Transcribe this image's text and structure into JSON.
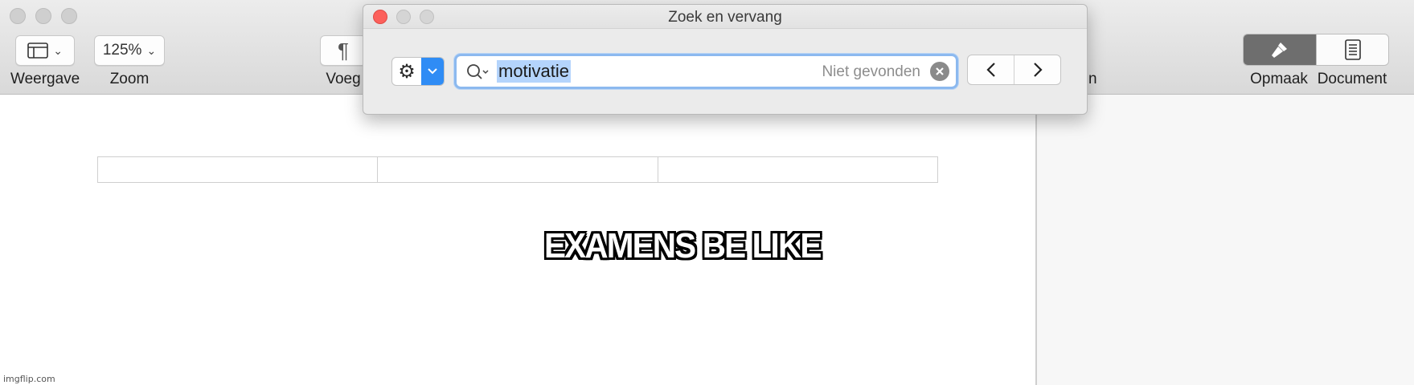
{
  "toolbar": {
    "view": {
      "label": "Weergave",
      "icon": "sidebar-layout-icon"
    },
    "zoom": {
      "label": "Zoom",
      "value": "125%"
    },
    "insert": {
      "label": "Voeg",
      "icon": "pilcrow-icon",
      "glyph": "¶"
    },
    "format": {
      "label": "Opmaak",
      "icon": "paintbrush-icon",
      "active": true
    },
    "document": {
      "label": "Document",
      "icon": "document-icon"
    },
    "hidden_label_fragment": "n"
  },
  "find_replace": {
    "title": "Zoek en vervang",
    "search_value": "motivatie",
    "status": "Niet gevonden",
    "accent_color": "#2f8cf5",
    "highlight_color": "#b4d4fc"
  },
  "document": {
    "caption": "EXAMENS BE LIKE",
    "table_columns": 3
  },
  "watermark": "imgflip.com"
}
